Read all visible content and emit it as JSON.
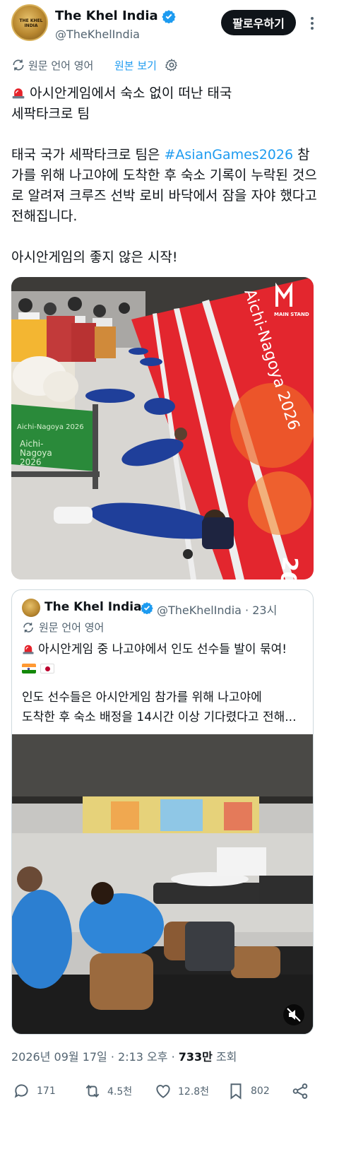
{
  "author": {
    "display_name": "The Khel India",
    "handle": "@TheKhelIndia",
    "avatar_text": "THE KHEL INDIA",
    "follow_label": "팔로우하기"
  },
  "translation": {
    "label": "원문 언어 영어",
    "show_original": "원본 보기"
  },
  "tweet": {
    "line1": "아시안게임에서 숙소 없이 떠난 태국",
    "line2": "세팍타크로 팀",
    "para2_before": "태국 국가 세팍타크로 팀은 ",
    "hashtag": "#AsianGames2026",
    "para2_after": " 참가를 위해 나고야에 도착한 후 숙소 기록이 누락된 것으로 알려져 크루즈 선박 로비 바닥에서 잠을 자야 했다고 전해집니다.",
    "para3": "아시안게임의 좋지 않은 시작!"
  },
  "photo1": {
    "banner_text_1": "Aichi-Nagoya 2026",
    "banner_text_2": "Aichi-\nNagoya\n2026",
    "watermark": "MAIN STAND",
    "corner_text": "2026",
    "colors": {
      "banner_red": "#e3262e",
      "green": "#2a8a3a",
      "tracksuit": "#1f3f9a"
    }
  },
  "quote": {
    "display_name": "The Khel India",
    "handle_time": "@TheKhelIndia · 23시",
    "translation_label": "원문 언어 영어",
    "line1": "아시안게임 중 나고야에서 인도 선수들 발이 묶여!",
    "line2": "인도 선수들은 아시안게임 참가를 위해 나고야에",
    "line3": "도착한 후 숙소 배정을 14시간 이상 기다렸다고 전해..."
  },
  "meta": {
    "date_time": "2026년 09월 17일 · 2:13 오후 · ",
    "views": "733만",
    "views_label": " 조회"
  },
  "actions": {
    "replies": "171",
    "reposts": "4.5천",
    "likes": "12.8천",
    "bookmarks": "802"
  },
  "colors": {
    "link": "#1d9bf0",
    "text": "#0f1419",
    "secondary": "#536471",
    "border": "#cfd9de"
  }
}
